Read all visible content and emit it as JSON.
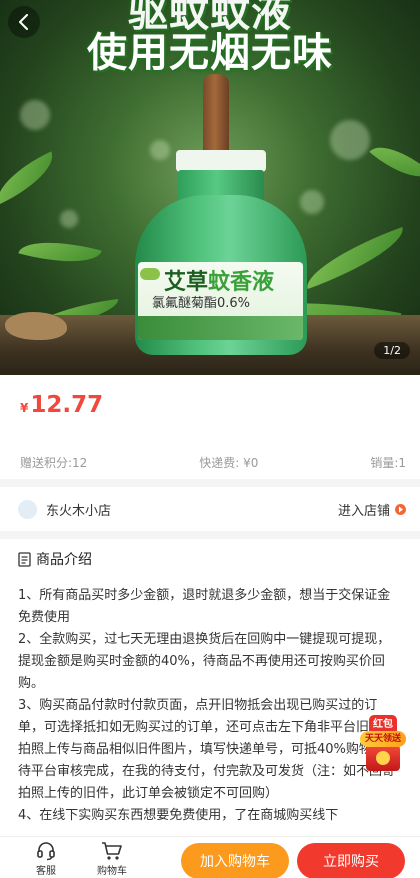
{
  "hero": {
    "headline_top": "驱蚊蚊液",
    "headline_main": "使用无烟无味",
    "product_label_big_a": "艾草",
    "product_label_big_b": "蚊香液",
    "product_label_small": "氯氟醚菊酯0.6%",
    "image_indicator": "1/2"
  },
  "price": {
    "currency": "¥",
    "value": "12.77"
  },
  "info": {
    "points": "赠送积分:12",
    "shipping": "快递费: ¥0",
    "sales": "销量:1"
  },
  "store": {
    "name": "东火木小店",
    "enter_label": "进入店铺"
  },
  "section": {
    "title": "商品介绍"
  },
  "description": "1、所有商品买时多少金额，退时就退多少金额，想当于交保证金免费使用\n2、全款购买，过七天无理由退换货后在回购中一键提现可提现，提现金额是购买时金额的40%，待商品不再使用还可按购买价回购。\n3、购买商品付款时付款页面，点开旧物抵会出现已购买过的订单，可选择抵扣如无购买过的订单，还可点击左下角非平台旧件，拍照上传与商品相似旧件图片，填写快递单号，可抵40%购物款，待平台审核完成，在我的待支付，付完款及可发货（注：如不回寄拍照上传的旧件，此订单会被锁定不可回购）\n4、在线下实购买东西想要免费使用，了在商城购买线下",
  "red_packet": {
    "tag": "红包",
    "ribbon": "天天领送"
  },
  "bottom_bar": {
    "service_label": "客服",
    "cart_label": "购物车",
    "add_to_cart": "加入购物车",
    "buy_now": "立即购买"
  },
  "colors": {
    "price_red": "#f0483b",
    "cart_orange": "#fb9a1d",
    "buy_red": "#f1392d"
  }
}
